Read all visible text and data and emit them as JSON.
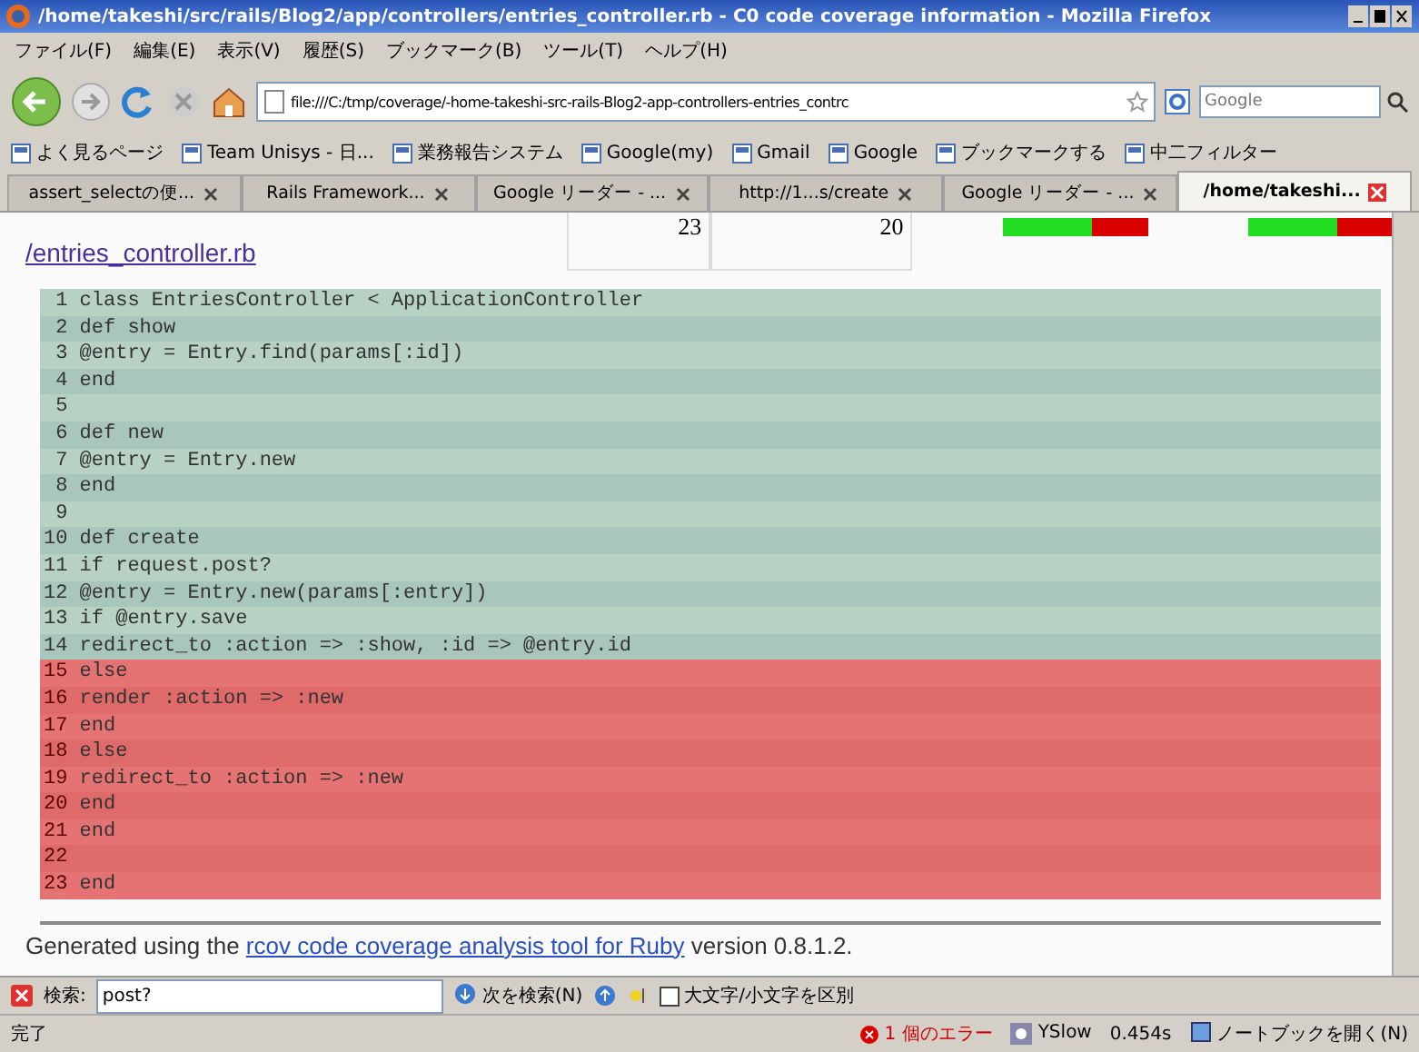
{
  "window": {
    "title": "/home/takeshi/src/rails/Blog2/app/controllers/entries_controller.rb - C0 code coverage information - Mozilla Firefox"
  },
  "menu": [
    "ファイル(F)",
    "編集(E)",
    "表示(V)",
    "履歴(S)",
    "ブックマーク(B)",
    "ツール(T)",
    "ヘルプ(H)"
  ],
  "address": {
    "value": "file:///C:/tmp/coverage/-home-takeshi-src-rails-Blog2-app-controllers-entries_contrc"
  },
  "search": {
    "placeholder": "Google"
  },
  "bookmarks": [
    "よく見るページ",
    "Team Unisys - 日...",
    "業務報告システム",
    "Google(my)",
    "Gmail",
    "Google",
    "ブックマークする",
    "中二フィルター"
  ],
  "tabs": [
    {
      "label": "assert_selectの便...",
      "selected": false
    },
    {
      "label": "Rails Framework...",
      "selected": false
    },
    {
      "label": "Google リーダー - ...",
      "selected": false
    },
    {
      "label": "http://1...s/create",
      "selected": false
    },
    {
      "label": "Google リーダー - ...",
      "selected": false
    },
    {
      "label": "/home/takeshi...",
      "selected": true
    }
  ],
  "file_row": {
    "link": "/entries_controller.rb",
    "total_lines": "23",
    "code_lines": "20",
    "coverage_bars": [
      {
        "level": 0.62
      },
      {
        "level": 0.62
      }
    ]
  },
  "code_lines": [
    {
      "number": "1",
      "code": "class EntriesController < ApplicationController",
      "covered": true
    },
    {
      "number": "2",
      "code": "def show",
      "covered": true
    },
    {
      "number": "3",
      "code": "@entry = Entry.find(params[:id])",
      "covered": true
    },
    {
      "number": "4",
      "code": "end",
      "covered": true
    },
    {
      "number": "5",
      "covered": true
    },
    {
      "number": "6",
      "code": "def new",
      "covered": true
    },
    {
      "number": "7",
      "code": "@entry = Entry.new",
      "covered": true
    },
    {
      "number": "8",
      "code": "end",
      "covered": true
    },
    {
      "number": "9",
      "covered": true
    },
    {
      "number": "10",
      "code": "def create",
      "covered": true
    },
    {
      "number": "11",
      "code": "if request.post?",
      "covered": true
    },
    {
      "number": "12",
      "code": "@entry = Entry.new(params[:entry])",
      "covered": true
    },
    {
      "number": "13",
      "code": "if @entry.save",
      "covered": true
    },
    {
      "number": "14",
      "code": "redirect_to :action => :show, :id => @entry.id",
      "covered": true
    },
    {
      "number": "15",
      "code": "else",
      "covered": false
    },
    {
      "number": "16",
      "code": "render :action => :new",
      "covered": false
    },
    {
      "number": "17",
      "code": "end",
      "covered": false
    },
    {
      "number": "18",
      "code": "else",
      "covered": false
    },
    {
      "number": "19",
      "code": "redirect_to :action => :new",
      "covered": false
    },
    {
      "number": "20",
      "code": "end",
      "covered": false
    },
    {
      "number": "21",
      "code": "end",
      "covered": false
    },
    {
      "number": "22",
      "covered": false
    },
    {
      "number": "23",
      "code": "end",
      "covered": false
    }
  ],
  "footer": {
    "before": "Generated using the",
    "link": "rcov code coverage analysis tool for Ruby",
    "after": "version 0.8.1.2."
  },
  "find_bar": {
    "label": "検索:",
    "value": "post?",
    "next": "次を検索(N)",
    "match_case": {
      "label": "大文字/小文字を区別",
      "checked": false
    }
  },
  "status_bar": {
    "text": "完了",
    "errors": "1 個のエラー",
    "yslow": "YSlow",
    "time": "0.454s",
    "notebook": "ノートブックを開く(N)"
  }
}
